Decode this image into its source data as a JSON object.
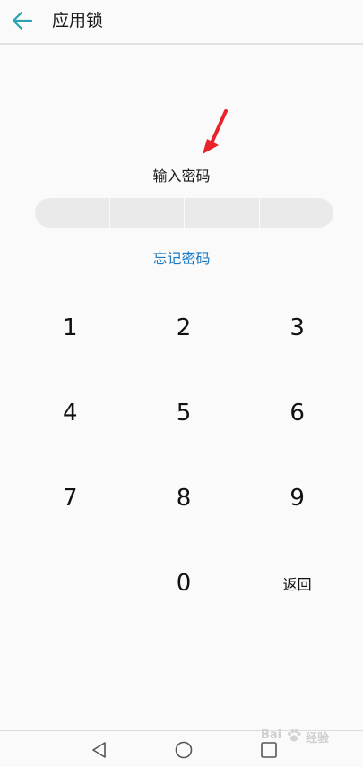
{
  "header": {
    "title": "应用锁",
    "back_icon": "arrow-left-icon"
  },
  "colors": {
    "accent": "#1a79c4",
    "back_icon": "#2aa3b0",
    "annotation_arrow": "#e8232b",
    "pin_bg": "#eaeaea"
  },
  "prompt": "输入密码",
  "forgot_link": "忘记密码",
  "keypad": {
    "k1": "1",
    "k2": "2",
    "k3": "3",
    "k4": "4",
    "k5": "5",
    "k6": "6",
    "k7": "7",
    "k8": "8",
    "k9": "9",
    "k0": "0",
    "back_label": "返回"
  },
  "navbar": {
    "back_icon": "triangle-back-icon",
    "home_icon": "circle-home-icon",
    "recents_icon": "square-recents-icon"
  },
  "watermark": {
    "logo_text": "Bai",
    "icon": "paw-icon",
    "text": "经验"
  }
}
